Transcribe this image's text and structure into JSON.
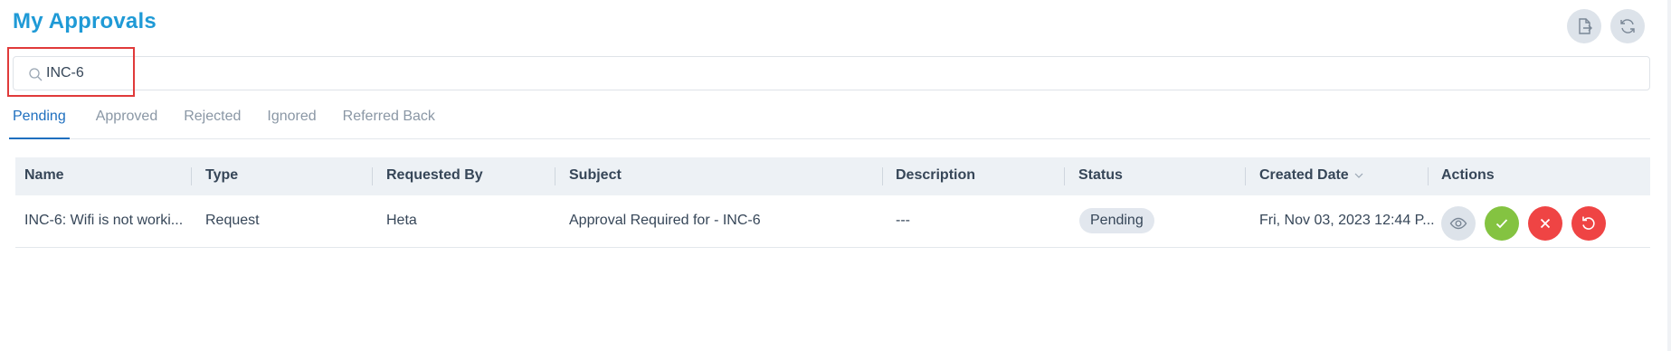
{
  "page": {
    "title": "My Approvals"
  },
  "toolbar": {
    "export_icon": "export-file-icon",
    "refresh_icon": "refresh-icon"
  },
  "search": {
    "value": "INC-6",
    "placeholder": ""
  },
  "tabs": [
    {
      "label": "Pending",
      "active": true
    },
    {
      "label": "Approved",
      "active": false
    },
    {
      "label": "Rejected",
      "active": false
    },
    {
      "label": "Ignored",
      "active": false
    },
    {
      "label": "Referred Back",
      "active": false
    }
  ],
  "table": {
    "headers": {
      "name": "Name",
      "type": "Type",
      "requested_by": "Requested By",
      "subject": "Subject",
      "description": "Description",
      "status": "Status",
      "created_date": "Created Date",
      "actions": "Actions"
    },
    "rows": [
      {
        "name": "INC-6: Wifi is not worki...",
        "type": "Request",
        "requested_by": "Heta",
        "subject": "Approval Required for - INC-6",
        "description": "---",
        "status": "Pending",
        "created_date": "Fri, Nov 03, 2023 12:44 P..."
      }
    ]
  },
  "colors": {
    "title": "#1f9ad6",
    "active_tab": "#1e6fbf",
    "approve": "#84c341",
    "reject": "#ef4444",
    "highlight": "#e03a3a"
  }
}
